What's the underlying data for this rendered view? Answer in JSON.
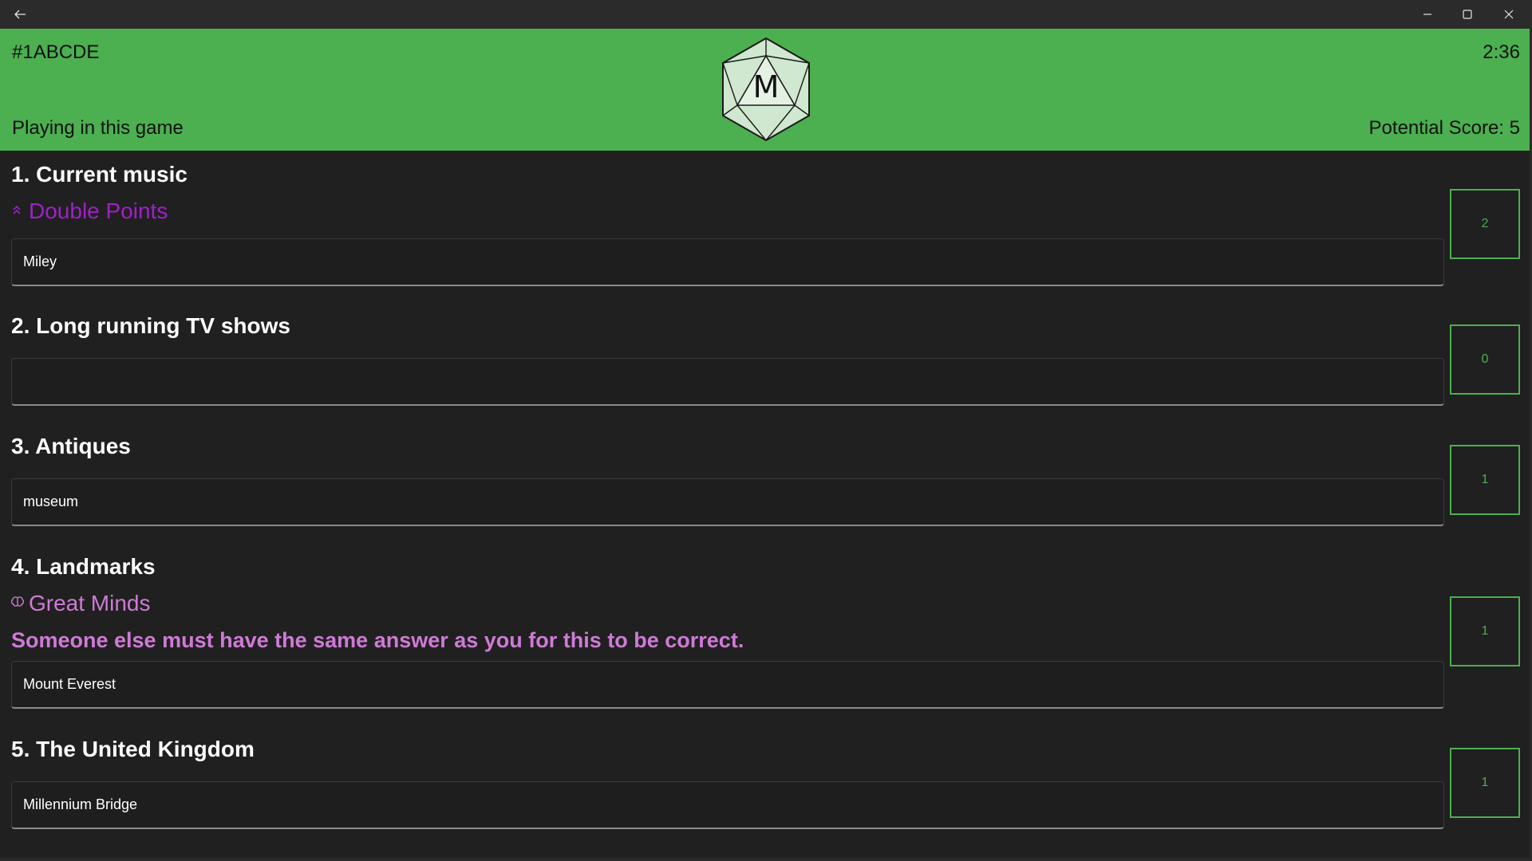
{
  "titlebar": {
    "back_icon": "arrow-left-icon",
    "min_icon": "minimize-icon",
    "max_icon": "maximize-icon",
    "close_icon": "close-icon"
  },
  "header": {
    "game_code": "#1ABCDE",
    "timer": "2:36",
    "status": "Playing in this game",
    "potential_score": "Potential Score: 5",
    "logo_letter": "M",
    "logo_icon": "d20-dice-icon",
    "background_color": "#4caf50"
  },
  "questions": [
    {
      "title": "1. Current music",
      "modifier": "Double Points",
      "modifier_icon": "double-chevron-up-icon",
      "modifier_color": "#a020c8",
      "answer": "Miley",
      "score": "2"
    },
    {
      "title": "2. Long running TV shows",
      "answer": "",
      "score": "0"
    },
    {
      "title": "3. Antiques",
      "answer": "museum",
      "score": "1"
    },
    {
      "title": "4. Landmarks",
      "modifier": "Great Minds",
      "modifier_icon": "brain-icon",
      "modifier_color": "#cf7ad6",
      "modifier_description": "Someone else must have the same answer as you for this to be correct.",
      "answer": "Mount Everest",
      "score": "1"
    },
    {
      "title": "5. The United Kingdom",
      "answer": "Millennium Bridge",
      "score": "1"
    }
  ]
}
